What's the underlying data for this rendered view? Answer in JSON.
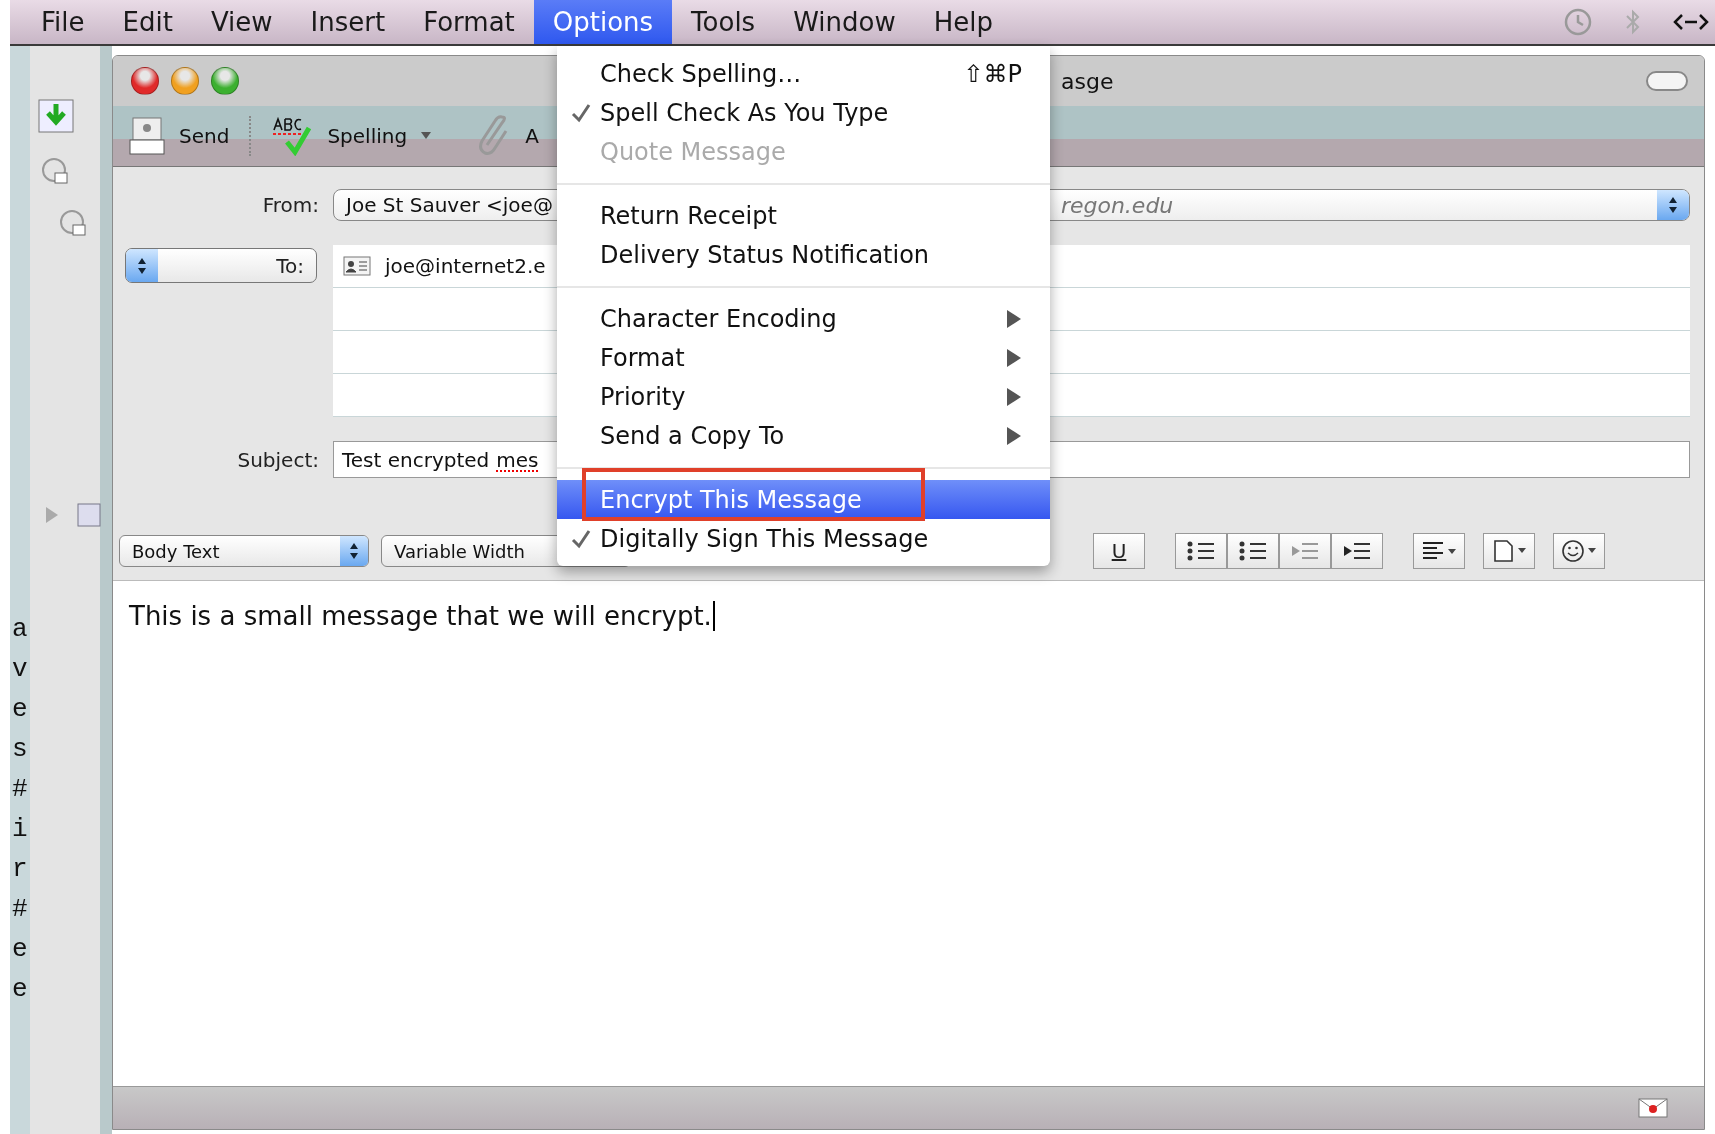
{
  "menu_bar": {
    "items": [
      {
        "label": "File",
        "selected": false
      },
      {
        "label": "Edit",
        "selected": false
      },
      {
        "label": "View",
        "selected": false
      },
      {
        "label": "Insert",
        "selected": false
      },
      {
        "label": "Format",
        "selected": false
      },
      {
        "label": "Options",
        "selected": true
      },
      {
        "label": "Tools",
        "selected": false
      },
      {
        "label": "Window",
        "selected": false
      },
      {
        "label": "Help",
        "selected": false
      }
    ]
  },
  "background_window": {
    "text_fragments": [
      "a",
      "v",
      "e",
      "s",
      "#",
      "i",
      "r",
      "#",
      "e",
      "e"
    ]
  },
  "compose_window": {
    "title": "asge",
    "toolbar": {
      "send": "Send",
      "spelling": "Spelling",
      "attach": "A"
    },
    "from": {
      "label": "From:",
      "value": "Joe St Sauver <joe@",
      "account": "regon.edu"
    },
    "to": {
      "label": "To:",
      "recipients": [
        "joe@internet2.e"
      ]
    },
    "subject": {
      "label": "Subject:",
      "segments": [
        {
          "text": "Test encrypted",
          "misspelled": false
        },
        {
          "text": "mes",
          "misspelled": true
        }
      ]
    },
    "format_bar": {
      "paragraph_style": "Body Text",
      "font": "Variable Width",
      "underline": "U"
    },
    "body": {
      "text": "This is a small message that we will encrypt."
    }
  },
  "options_menu": {
    "sections": [
      [
        {
          "label": "Check Spelling…",
          "shortcut": "⇧⌘P",
          "checked": false,
          "disabled": false,
          "submenu": false,
          "selected": false,
          "annotated": false
        },
        {
          "label": "Spell Check As You Type",
          "checked": true,
          "disabled": false,
          "submenu": false,
          "selected": false,
          "annotated": false
        },
        {
          "label": "Quote Message",
          "checked": false,
          "disabled": true,
          "submenu": false,
          "selected": false,
          "annotated": false
        }
      ],
      [
        {
          "label": "Return Receipt",
          "checked": false,
          "disabled": false,
          "submenu": false,
          "selected": false,
          "annotated": false
        },
        {
          "label": "Delivery Status Notification",
          "checked": false,
          "disabled": false,
          "submenu": false,
          "selected": false,
          "annotated": false
        }
      ],
      [
        {
          "label": "Character Encoding",
          "checked": false,
          "disabled": false,
          "submenu": true,
          "selected": false,
          "annotated": false
        },
        {
          "label": "Format",
          "checked": false,
          "disabled": false,
          "submenu": true,
          "selected": false,
          "annotated": false
        },
        {
          "label": "Priority",
          "checked": false,
          "disabled": false,
          "submenu": true,
          "selected": false,
          "annotated": false
        },
        {
          "label": "Send a Copy To",
          "checked": false,
          "disabled": false,
          "submenu": true,
          "selected": false,
          "annotated": false
        }
      ],
      [
        {
          "label": "Encrypt This Message",
          "checked": false,
          "disabled": false,
          "submenu": false,
          "selected": true,
          "annotated": true
        },
        {
          "label": "Digitally Sign This Message",
          "checked": true,
          "disabled": false,
          "submenu": false,
          "selected": false,
          "annotated": false
        }
      ]
    ]
  }
}
